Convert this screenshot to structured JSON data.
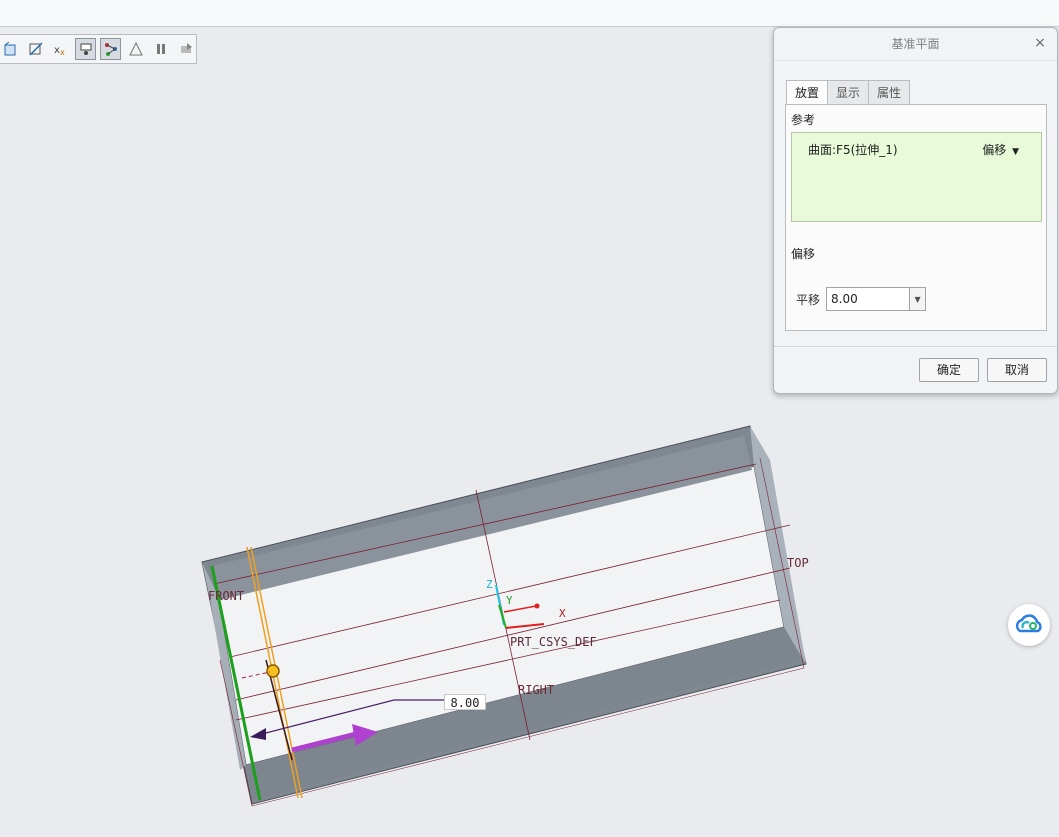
{
  "dialog": {
    "title": "基准平面",
    "close_icon": "close-icon",
    "tabs": [
      {
        "label": "放置",
        "active": true
      },
      {
        "label": "显示",
        "active": false
      },
      {
        "label": "属性",
        "active": false
      }
    ],
    "references_label": "参考",
    "reference_item": "曲面:F5(拉伸_1)",
    "reference_mode": "偏移",
    "offset_section_label": "偏移",
    "translate_label": "平移",
    "translate_value": "8.00",
    "ok_label": "确定",
    "cancel_label": "取消",
    "ref_box_color": "#e8fad8"
  },
  "toolbar": {
    "icons": [
      "datum-plane-display-icon",
      "datum-axis-display-icon",
      "datum-point-display-icon",
      "csys-display-icon",
      "annotation-display-icon",
      "spin-center-icon",
      "pause-icon",
      "feature-preview-icon"
    ]
  },
  "viewport": {
    "labels": {
      "front": "FRONT",
      "top": "TOP",
      "right": "RIGHT",
      "csys": "PRT_CSYS_DEF",
      "axis_x": "X",
      "axis_y": "Y",
      "axis_z": "Z"
    },
    "dimension_value": "8.00",
    "colors": {
      "body": "#7f8891",
      "datum": "#7a2030",
      "selected_edge": "#1aa01a",
      "preview_plane": "#f0a020",
      "drag_arrow": "#b040d0"
    }
  },
  "floating": {
    "cloud_icon": "cloud-sync-icon"
  }
}
